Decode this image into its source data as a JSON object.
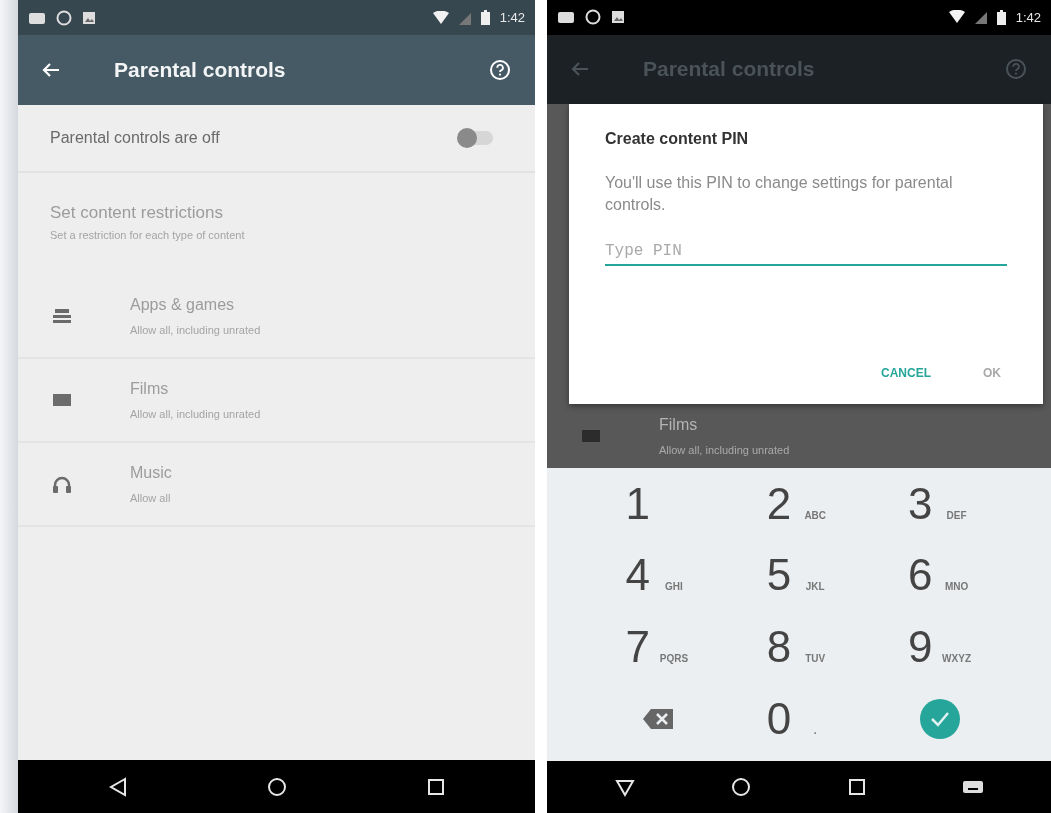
{
  "screens": [
    {
      "status_bar": {
        "time": "1:42"
      },
      "toolbar": {
        "title": "Parental controls",
        "dimmed": false
      },
      "master_switch": {
        "label": "Parental controls are off",
        "on": false
      },
      "section": {
        "title": "Set content restrictions",
        "subtitle": "Set a restriction for each type of content",
        "disabled": true
      },
      "categories": [
        {
          "kind": "apps",
          "title": "Apps & games",
          "subtitle": "Allow all, including unrated",
          "disabled": true
        },
        {
          "kind": "films",
          "title": "Films",
          "subtitle": "Allow all, including unrated",
          "disabled": true
        },
        {
          "kind": "music",
          "title": "Music",
          "subtitle": "Allow all",
          "disabled": true
        }
      ],
      "nav_buttons": [
        {
          "kind": "back"
        },
        {
          "kind": "home"
        },
        {
          "kind": "recents"
        }
      ]
    },
    {
      "status_bar": {
        "time": "1:42"
      },
      "toolbar": {
        "title": "Parental controls",
        "dimmed": true
      },
      "dialog": {
        "title": "Create content PIN",
        "message": "You'll use this PIN to change settings for parental controls.",
        "pin_field": {
          "placeholder": "Type PIN"
        },
        "buttons": [
          {
            "label": "CANCEL",
            "disabled": false
          },
          {
            "label": "OK",
            "disabled": true
          }
        ]
      },
      "categories": [
        {
          "kind": "films",
          "title": "Films",
          "subtitle": "Allow all, including unrated",
          "disabled": true
        }
      ],
      "keypad": [
        {
          "kind": "digit",
          "digit": "1"
        },
        {
          "kind": "digit",
          "digit": "2",
          "letters": "ABC"
        },
        {
          "kind": "digit",
          "digit": "3",
          "letters": "DEF"
        },
        {
          "kind": "digit",
          "digit": "4",
          "letters": "GHI"
        },
        {
          "kind": "digit",
          "digit": "5",
          "letters": "JKL"
        },
        {
          "kind": "digit",
          "digit": "6",
          "letters": "MNO"
        },
        {
          "kind": "digit",
          "digit": "7",
          "letters": "PQRS"
        },
        {
          "kind": "digit",
          "digit": "8",
          "letters": "TUV"
        },
        {
          "kind": "digit",
          "digit": "9",
          "letters": "WXYZ"
        },
        {
          "kind": "backspace"
        },
        {
          "kind": "digit",
          "digit": "0",
          "letters": "."
        },
        {
          "kind": "done"
        }
      ],
      "nav_buttons": [
        {
          "kind": "back-down"
        },
        {
          "kind": "home"
        },
        {
          "kind": "recents"
        },
        {
          "kind": "keyboard"
        }
      ]
    }
  ]
}
